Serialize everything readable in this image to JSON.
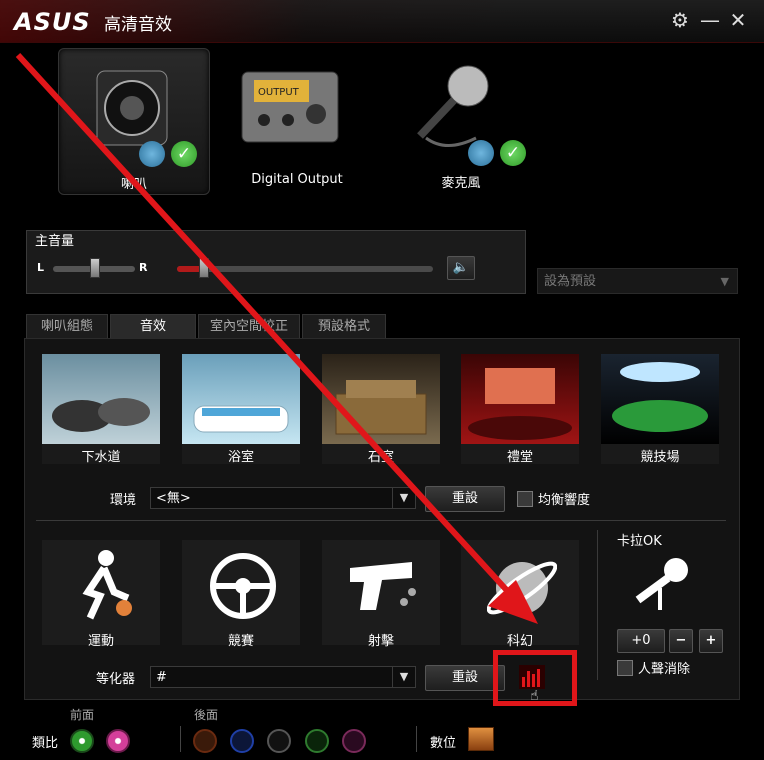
{
  "app": {
    "title": "高清音效",
    "brand": "ASUS"
  },
  "devices": [
    {
      "label": "喇叭",
      "selected": true
    },
    {
      "label": "Digital Output",
      "selected": false,
      "screen_text": "OUTPUT"
    },
    {
      "label": "麥克風",
      "selected": false
    }
  ],
  "master": {
    "title": "主音量",
    "left_label": "L",
    "right_label": "R"
  },
  "preset": {
    "value": "設為預設"
  },
  "tabs": [
    "喇叭組態",
    "音效",
    "室內空間校正",
    "預設格式"
  ],
  "environments": [
    "下水道",
    "浴室",
    "石室",
    "禮堂",
    "競技場"
  ],
  "environment_row": {
    "label": "環境",
    "value": "<無>",
    "reset": "重設",
    "checkbox_label": "均衡響度"
  },
  "equalizer": {
    "presets": [
      "運動",
      "競賽",
      "射擊",
      "科幻"
    ],
    "label": "等化器",
    "value": "#",
    "reset": "重設"
  },
  "karaoke": {
    "title": "卡拉OK",
    "value": "+0",
    "minus": "−",
    "plus": "+",
    "checkbox_label": "人聲消除"
  },
  "footer": {
    "front": "前面",
    "rear": "後面",
    "analog": "類比",
    "digital": "數位"
  },
  "colors": {
    "accent_red": "#e0161a",
    "jack_green": "#2e9a2e",
    "jack_pink": "#d43f9a",
    "jack_orange": "#b04a1a",
    "jack_blue": "#1f3fa6",
    "jack_gray": "#666666"
  }
}
